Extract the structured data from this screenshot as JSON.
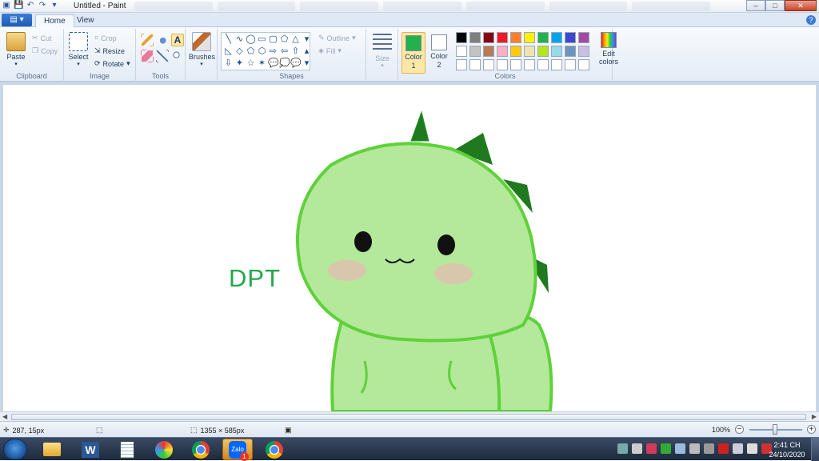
{
  "window": {
    "title": "Untitled - Paint"
  },
  "window_buttons": {
    "minimize": "–",
    "maximize": "□",
    "close": "✕"
  },
  "tabs": {
    "file": "▤ ▾",
    "home": "Home",
    "view": "View"
  },
  "help": "?",
  "ribbon": {
    "clipboard": {
      "label": "Clipboard",
      "paste": "Paste",
      "cut": "Cut",
      "copy": "Copy"
    },
    "image": {
      "label": "Image",
      "select": "Select",
      "crop": "Crop",
      "resize": "Resize",
      "rotate": "Rotate"
    },
    "tools": {
      "label": "Tools"
    },
    "brushes": {
      "label": "Brushes"
    },
    "shapes": {
      "label": "Shapes",
      "outline": "Outline",
      "fill": "Fill",
      "glyphs": [
        "╲",
        "∿",
        "◯",
        "▭",
        "▢",
        "⬠",
        "△",
        "▾",
        "◺",
        "◇",
        "⬠",
        "⬡",
        "⇨",
        "⇦",
        "⇧",
        "▴",
        "⇩",
        "✦",
        "☆",
        "✶",
        "💬",
        "💭",
        "💬",
        "▾"
      ]
    },
    "size": {
      "label": "Size"
    },
    "colors": {
      "label": "Colors",
      "color1": {
        "label_line1": "Color",
        "label_line2": "1",
        "value": "#22b14c"
      },
      "color2": {
        "label_line1": "Color",
        "label_line2": "2",
        "value": "#ffffff"
      },
      "edit_line1": "Edit",
      "edit_line2": "colors",
      "palette": [
        "#000000",
        "#7f7f7f",
        "#880015",
        "#ed1c24",
        "#ff7f27",
        "#fff200",
        "#22b14c",
        "#00a2e8",
        "#3f48cc",
        "#a349a4",
        "#ffffff",
        "#c3c3c3",
        "#b97a57",
        "#ffaec9",
        "#ffc90e",
        "#efe4b0",
        "#b5e61d",
        "#99d9ea",
        "#7092be",
        "#c8bfe7",
        "#ffffff",
        "#ffffff",
        "#ffffff",
        "#ffffff",
        "#ffffff",
        "#ffffff",
        "#ffffff",
        "#ffffff",
        "#ffffff",
        "#ffffff"
      ]
    }
  },
  "canvas": {
    "text": "DPT"
  },
  "status": {
    "cursor": "287, 15px",
    "size": "1355 × 585px",
    "zoom": "100%"
  },
  "taskbar": {
    "apps": [
      "folder-icon",
      "word-icon",
      "notepad-icon",
      "paint-icon",
      "chrome-icon",
      "zalo-icon",
      "chrome-icon"
    ],
    "zalo_badge": "1",
    "zalo_text": "Zalo",
    "word_letter": "W",
    "time": "2:41 CH",
    "date": "24/10/2020"
  }
}
